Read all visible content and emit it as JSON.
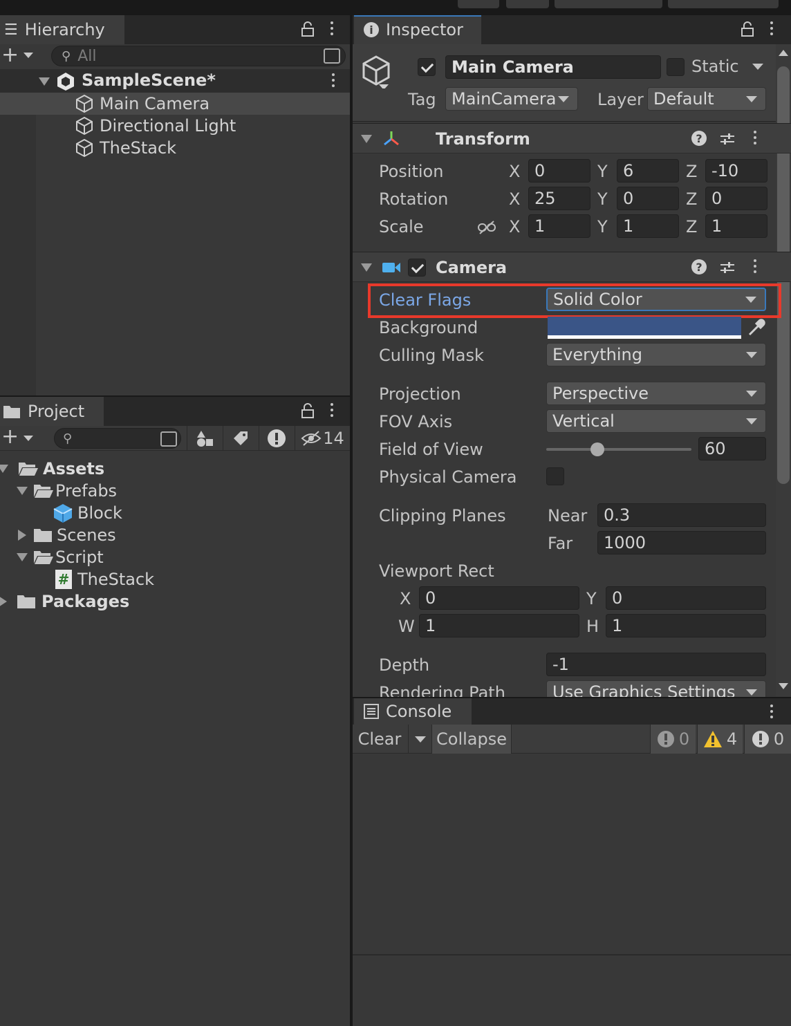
{
  "hierarchy": {
    "tab_label": "Hierarchy",
    "search_placeholder": "All",
    "scene_name": "SampleScene*",
    "items": [
      {
        "label": "Main Camera"
      },
      {
        "label": "Directional Light"
      },
      {
        "label": "TheStack"
      }
    ]
  },
  "project": {
    "tab_label": "Project",
    "hidden_count": "14",
    "tree": [
      {
        "label": "Assets"
      },
      {
        "label": "Prefabs"
      },
      {
        "label": "Block"
      },
      {
        "label": "Scenes"
      },
      {
        "label": "Script"
      },
      {
        "label": "TheStack"
      },
      {
        "label": "Packages"
      }
    ]
  },
  "inspector": {
    "tab_label": "Inspector",
    "object_name": "Main Camera",
    "static_label": "Static",
    "tag_label": "Tag",
    "tag_value": "MainCamera",
    "layer_label": "Layer",
    "layer_value": "Default",
    "transform": {
      "title": "Transform",
      "position_label": "Position",
      "rotation_label": "Rotation",
      "scale_label": "Scale",
      "position": {
        "x": "0",
        "y": "6",
        "z": "-10"
      },
      "rotation": {
        "x": "25",
        "y": "0",
        "z": "0"
      },
      "scale": {
        "x": "1",
        "y": "1",
        "z": "1"
      },
      "axis_x": "X",
      "axis_y": "Y",
      "axis_z": "Z"
    },
    "camera": {
      "title": "Camera",
      "clear_flags_label": "Clear Flags",
      "clear_flags_value": "Solid Color",
      "background_label": "Background",
      "background_color": "#3a5587",
      "culling_mask_label": "Culling Mask",
      "culling_mask_value": "Everything",
      "projection_label": "Projection",
      "projection_value": "Perspective",
      "fov_axis_label": "FOV Axis",
      "fov_axis_value": "Vertical",
      "fov_label": "Field of View",
      "fov_value": "60",
      "physical_camera_label": "Physical Camera",
      "clipping_planes_label": "Clipping Planes",
      "near_label": "Near",
      "near_value": "0.3",
      "far_label": "Far",
      "far_value": "1000",
      "viewport_rect_label": "Viewport Rect",
      "vp_x_label": "X",
      "vp_x": "0",
      "vp_y_label": "Y",
      "vp_y": "0",
      "vp_w_label": "W",
      "vp_w": "1",
      "vp_h_label": "H",
      "vp_h": "1",
      "depth_label": "Depth",
      "depth_value": "-1",
      "rendering_path_label": "Rendering Path",
      "rendering_path_value": "Use Graphics Settings"
    }
  },
  "console": {
    "tab_label": "Console",
    "clear_label": "Clear",
    "collapse_label": "Collapse",
    "error_count": "0",
    "warning_count": "4",
    "message_count": "0"
  },
  "colors": {
    "highlight_border": "#e8392b",
    "selected_label": "#7ba7e6",
    "accent": "#3a79bb"
  }
}
